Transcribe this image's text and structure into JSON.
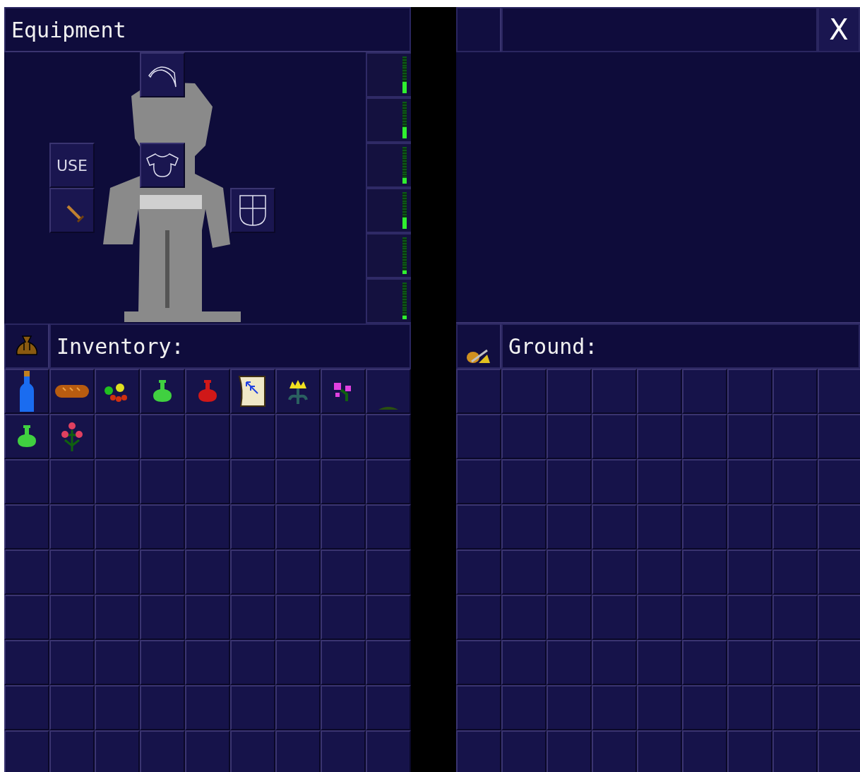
{
  "equipment": {
    "title": "Equipment",
    "slots": [
      {
        "kind": "head"
      },
      {
        "kind": "use",
        "label": "USE"
      },
      {
        "kind": "body"
      },
      {
        "kind": "weapon"
      },
      {
        "kind": "shield"
      }
    ],
    "meters": [
      {
        "level": 0.3
      },
      {
        "level": 0.3
      },
      {
        "level": 0.15
      },
      {
        "level": 0.3
      },
      {
        "level": 0.1
      },
      {
        "level": 0.1
      }
    ]
  },
  "inventory": {
    "title": "Inventory:",
    "items": [
      {
        "kind": "bottle"
      },
      {
        "kind": "bread"
      },
      {
        "kind": "fruit"
      },
      {
        "kind": "potion",
        "color": "#40d040"
      },
      {
        "kind": "potion",
        "color": "#d01818"
      },
      {
        "kind": "scroll"
      },
      {
        "kind": "yellow-flower"
      },
      {
        "kind": "pink-flower"
      },
      {
        "kind": "herb"
      },
      {
        "kind": "potion",
        "color": "#40d040"
      },
      {
        "kind": "red-flower"
      }
    ]
  },
  "ground": {
    "title": "Ground:",
    "close": "X"
  }
}
